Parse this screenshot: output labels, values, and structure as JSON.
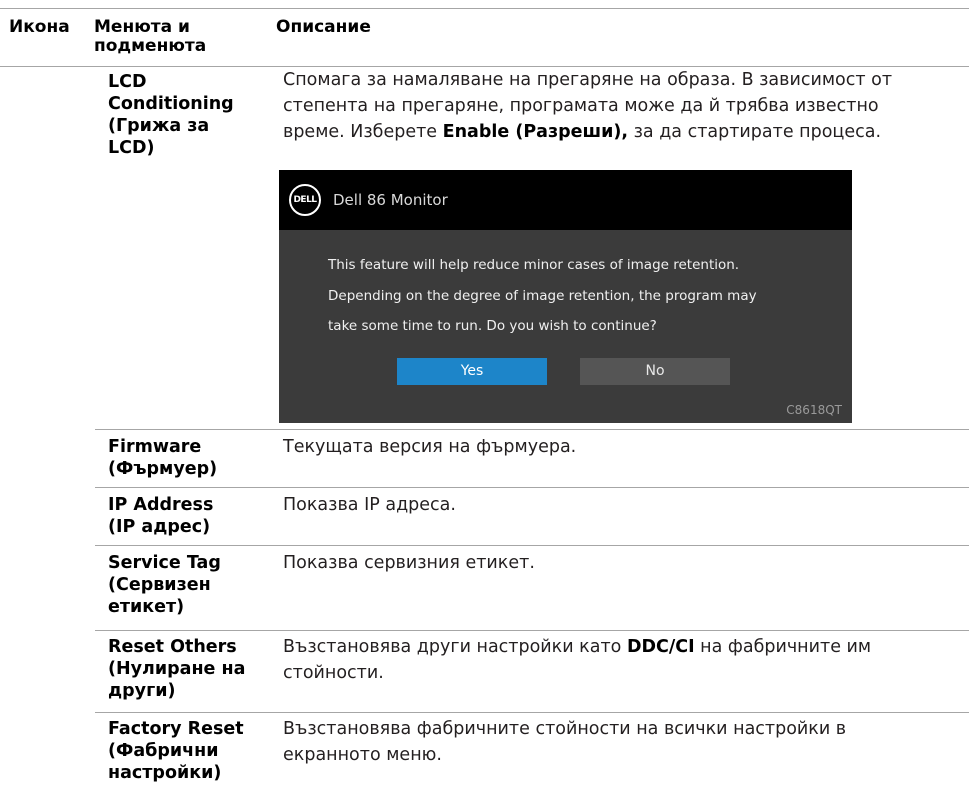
{
  "header": {
    "col_icon": "Икона",
    "col_menu_line1": "Менюта и",
    "col_menu_line2": "подменюта",
    "col_desc": "Описание"
  },
  "rows": {
    "lcd": {
      "name_line1": "LCD",
      "name_line2": "Conditioning",
      "name_line3": "(Грижа за",
      "name_line4": "LCD)",
      "desc_line1": "Спомага за намаляване на прегаряне на образа. В зависимост от",
      "desc_line2": "степента на прегаряне, програмата може да й трябва известно",
      "desc_line3_pre": "време. Изберете ",
      "desc_line3_bold": "Enable (Разреши),",
      "desc_line3_post": " за да стартирате процеса."
    },
    "firmware": {
      "name_line1": "Firmware",
      "name_line2": "(Фърмуер)",
      "desc": "Текущата версия на фърмуера."
    },
    "ip": {
      "name_line1": "IP Address",
      "name_line2": "(IP адрес)",
      "desc": "Показва IP адреса."
    },
    "service": {
      "name_line1": "Service Tag",
      "name_line2": "(Сервизен",
      "name_line3": "етикет)",
      "desc": "Показва сервизния етикет."
    },
    "reset_others": {
      "name_line1": "Reset Others",
      "name_line2": "(Нулиране на",
      "name_line3": "други)",
      "desc_line1_pre": "Възстановява други настройки като ",
      "desc_line1_bold": "DDC/CI",
      "desc_line1_post": " на фабричните им",
      "desc_line2": "стойности."
    },
    "factory_reset": {
      "name_line1": "Factory Reset",
      "name_line2": "(Фабрични",
      "name_line3": "настройки)",
      "desc_line1": "Възстановява фабричните стойности на всички настройки в",
      "desc_line2": "екранното меню."
    }
  },
  "dialog": {
    "logo": "DELL",
    "title": "Dell 86 Monitor",
    "message_line1": "This feature will help reduce minor cases of image retention.",
    "message_line2": "Depending on the degree of image retention, the program may",
    "message_line3": "take some time to run. Do you wish to continue?",
    "yes_label": "Yes",
    "no_label": "No",
    "model": "C8618QT"
  },
  "colors": {
    "rule": "#a6a6a6",
    "dialog_bg": "#3b3b3b",
    "dialog_header": "#000000",
    "yes_button": "#1d85c9",
    "no_button": "#555555"
  }
}
